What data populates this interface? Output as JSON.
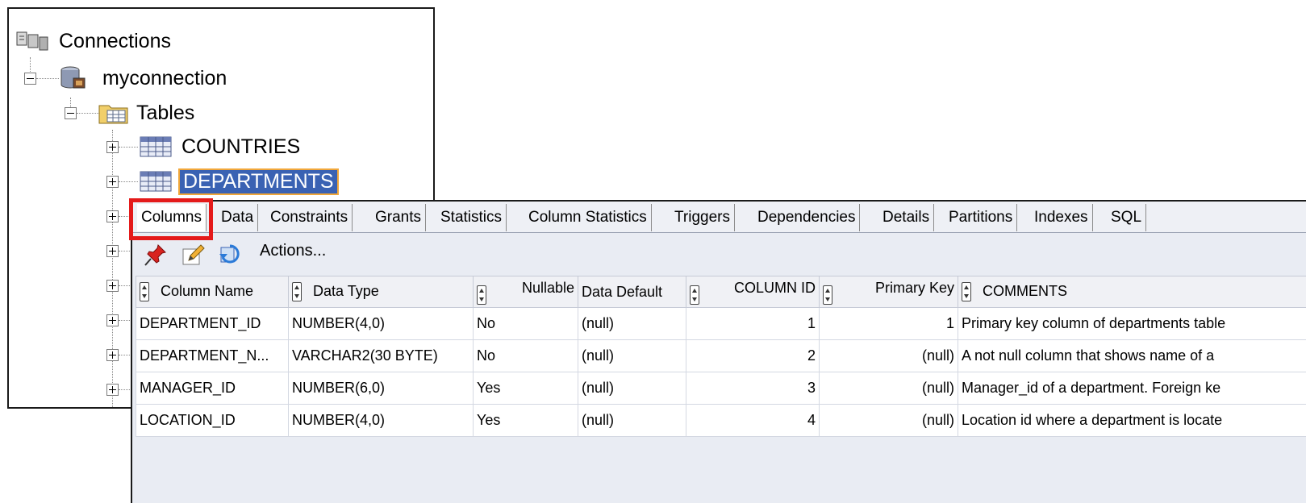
{
  "tree": {
    "root": {
      "label": "Connections",
      "icon": "connections-icon"
    },
    "connection": {
      "label": "myconnection",
      "icon": "database-connection-icon"
    },
    "folder": {
      "label": "Tables",
      "icon": "folder-icon"
    },
    "tables": [
      {
        "label": "COUNTRIES",
        "icon": "table-icon",
        "selected": false
      },
      {
        "label": "DEPARTMENTS",
        "icon": "table-icon",
        "selected": true
      }
    ]
  },
  "tabs": [
    "Columns",
    "Data",
    "Constraints",
    "Grants",
    "Statistics",
    "Column Statistics",
    "Triggers",
    "Dependencies",
    "Details",
    "Partitions",
    "Indexes",
    "SQL"
  ],
  "active_tab": "Columns",
  "toolbar": {
    "icons": [
      "pin-icon",
      "edit-icon",
      "refresh-icon"
    ],
    "actions_label": "Actions..."
  },
  "grid": {
    "columns": [
      "Column Name",
      "Data Type",
      "Nullable",
      "Data Default",
      "COLUMN ID",
      "Primary Key",
      "COMMENTS"
    ],
    "rows": [
      [
        "DEPARTMENT_ID",
        "NUMBER(4,0)",
        "No",
        "(null)",
        "1",
        "1",
        "Primary key column of departments table"
      ],
      [
        "DEPARTMENT_N...",
        "VARCHAR2(30 BYTE)",
        "No",
        "(null)",
        "2",
        "(null)",
        "A not null column that shows name of a"
      ],
      [
        "MANAGER_ID",
        "NUMBER(6,0)",
        "Yes",
        "(null)",
        "3",
        "(null)",
        "Manager_id of a department. Foreign ke"
      ],
      [
        "LOCATION_ID",
        "NUMBER(4,0)",
        "Yes",
        "(null)",
        "4",
        "(null)",
        "Location id where a department is locate"
      ]
    ]
  },
  "colors": {
    "selection": "#3a62b3",
    "highlight_box": "#e41a1a",
    "panel_bg": "#e9ecf3"
  }
}
